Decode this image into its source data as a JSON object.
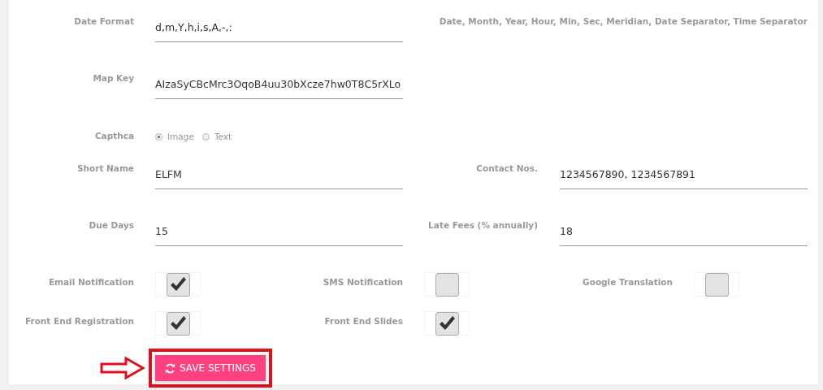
{
  "rows": [
    {
      "kind": "fields",
      "items": [
        {
          "label": "Date Format",
          "value": "d,m,Y,h,i,s,A,-,:"
        }
      ],
      "hint": "Date, Month, Year, Hour, Min, Sec, Meridian, Date Separator, Time Separator"
    },
    {
      "kind": "fields",
      "items": [
        {
          "label": "Map Key",
          "value": "AIzaSyCBcMrc3OqoB4uu30bXcze7hw0T8C5rXLo"
        }
      ]
    },
    {
      "kind": "radio",
      "label": "Capthca",
      "options": [
        {
          "label": "Image",
          "selected": true
        },
        {
          "label": "Text",
          "selected": false
        }
      ]
    },
    {
      "kind": "fields",
      "items": [
        {
          "label": "Short Name",
          "value": "ELFM"
        },
        {
          "label": "Contact Nos.",
          "value": "1234567890, 1234567891"
        }
      ]
    },
    {
      "kind": "fields",
      "items": [
        {
          "label": "Due Days",
          "value": "15"
        },
        {
          "label": "Late Fees (% annually)",
          "value": "18"
        }
      ]
    },
    {
      "kind": "checks",
      "items": [
        {
          "label": "Email Notification",
          "checked": true
        },
        {
          "label": "SMS Notification",
          "checked": false
        },
        {
          "label": "Google Translation",
          "checked": false
        }
      ]
    },
    {
      "kind": "checks",
      "items": [
        {
          "label": "Front End Registration",
          "checked": true
        },
        {
          "label": "Front End Slides",
          "checked": true
        }
      ]
    }
  ],
  "save_button": {
    "label": "SAVE SETTINGS"
  }
}
